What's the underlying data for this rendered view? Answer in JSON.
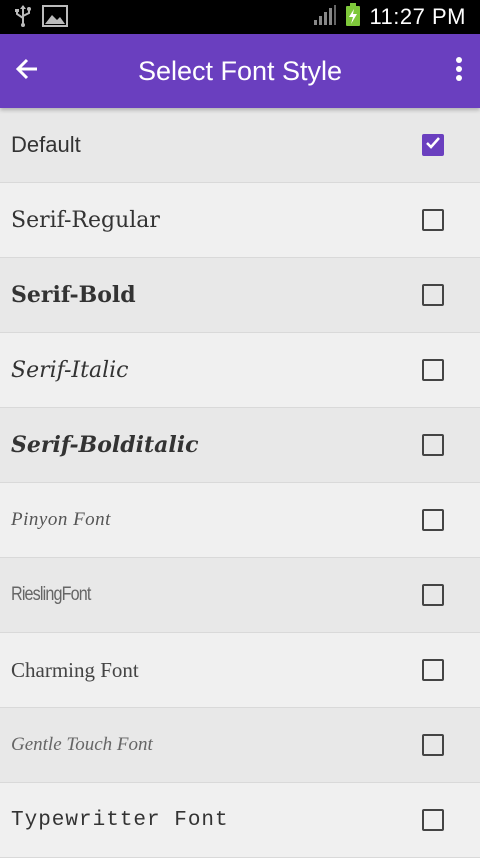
{
  "status_bar": {
    "time": "11:27 PM",
    "icons": [
      "usb-icon",
      "image-icon",
      "signal-icon",
      "battery-charging-icon"
    ]
  },
  "app_bar": {
    "title": "Select Font Style",
    "back_icon": "arrow-left-icon",
    "overflow_icon": "more-vertical-icon"
  },
  "colors": {
    "accent": "#6a3fbf",
    "status_bar": "#000000",
    "row_odd": "#e8e8e8",
    "row_even": "#f0f0f0"
  },
  "fonts": {
    "items": [
      {
        "label": "Default",
        "checked": true
      },
      {
        "label": "Serif-Regular",
        "checked": false
      },
      {
        "label": "Serif-Bold",
        "checked": false
      },
      {
        "label": "Serif-Italic",
        "checked": false
      },
      {
        "label": "Serif-Bolditalic",
        "checked": false
      },
      {
        "label": "Pinyon Font",
        "checked": false
      },
      {
        "label": "RieslingFont",
        "checked": false
      },
      {
        "label": "Charming Font",
        "checked": false
      },
      {
        "label": "Gentle Touch Font",
        "checked": false
      },
      {
        "label": "Typewritter Font",
        "checked": false
      }
    ]
  }
}
